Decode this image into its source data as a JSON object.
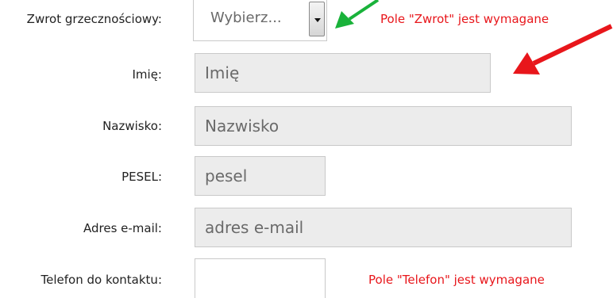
{
  "form": {
    "salutation": {
      "label": "Zwrot grzecznościowy:",
      "selected": "Wybierz...",
      "error": "Pole \"Zwrot\" jest wymagane"
    },
    "first_name": {
      "label": "Imię:",
      "placeholder": "Imię"
    },
    "last_name": {
      "label": "Nazwisko:",
      "placeholder": "Nazwisko"
    },
    "pesel": {
      "label": "PESEL:",
      "placeholder": "pesel"
    },
    "email": {
      "label": "Adres e-mail:",
      "placeholder": "adres e-mail"
    },
    "phone": {
      "label": "Telefon do kontaktu:",
      "error": "Pole \"Telefon\" jest wymagane"
    }
  },
  "annotations": {
    "green_arrow_color": "#19b23a",
    "red_arrow_color": "#e8161b"
  }
}
